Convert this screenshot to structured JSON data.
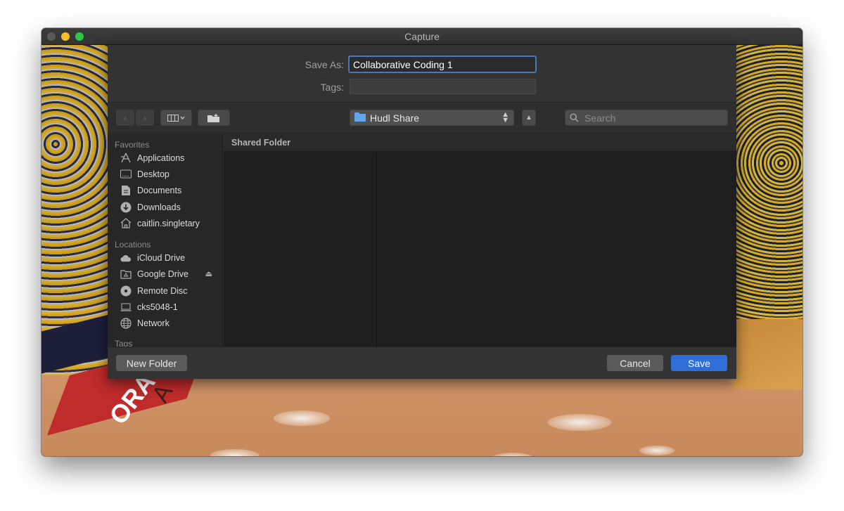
{
  "window": {
    "title": "Capture"
  },
  "video": {
    "arena_text": "A R E",
    "ora_text": "ORA"
  },
  "dialog": {
    "save_as_label": "Save As:",
    "save_as_value": "Collaborative Coding 1",
    "tags_label": "Tags:",
    "tags_value": "",
    "location": "Hudl Share",
    "search_placeholder": "Search",
    "browser_header": "Shared Folder",
    "new_folder_label": "New Folder",
    "cancel_label": "Cancel",
    "save_label": "Save"
  },
  "sidebar": {
    "favorites_title": "Favorites",
    "favorites": [
      {
        "label": "Applications",
        "icon": "applications-icon"
      },
      {
        "label": "Desktop",
        "icon": "desktop-icon"
      },
      {
        "label": "Documents",
        "icon": "documents-icon"
      },
      {
        "label": "Downloads",
        "icon": "downloads-icon"
      },
      {
        "label": "caitlin.singletary",
        "icon": "home-icon"
      }
    ],
    "locations_title": "Locations",
    "locations": [
      {
        "label": "iCloud Drive",
        "icon": "cloud-icon"
      },
      {
        "label": "Google Drive",
        "icon": "drive-icon"
      },
      {
        "label": "Remote Disc",
        "icon": "disc-icon"
      },
      {
        "label": "cks5048-1",
        "icon": "laptop-icon"
      },
      {
        "label": "Network",
        "icon": "network-icon"
      }
    ],
    "tags_title": "Tags"
  },
  "colors": {
    "accent": "#2f6ed8",
    "focus_ring": "#4b77b6",
    "folder": "#62a8e8"
  }
}
